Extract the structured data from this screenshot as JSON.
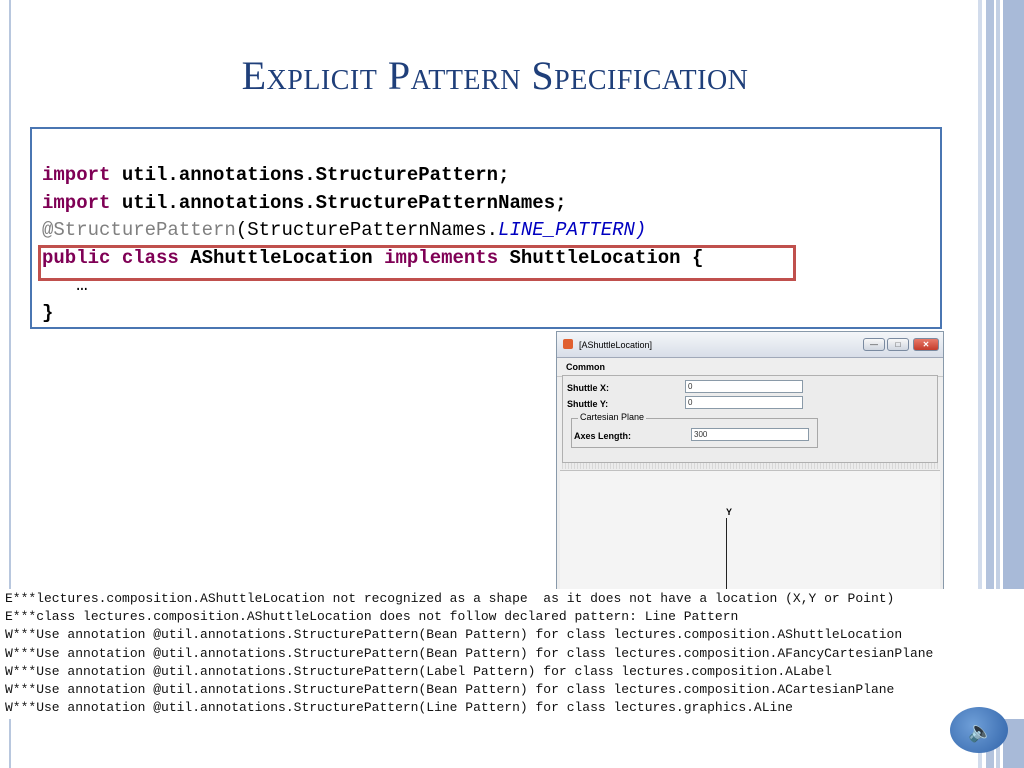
{
  "slide": {
    "title": "Explicit Pattern Specification",
    "code": {
      "line1": {
        "kw": "import",
        "rest": " util.annotations.StructurePattern;"
      },
      "line2": {
        "kw": "import",
        "rest": " util.annotations.StructurePatternNames;"
      },
      "line3": {
        "ann": "@StructurePattern",
        "mid": "(StructurePatternNames.",
        "const": "LINE_PATTERN",
        "end": ")"
      },
      "line4": {
        "kw1": "public",
        "kw2": "class",
        "name": "AShuttleLocation",
        "kw3": "implements",
        "iface": "ShuttleLocation",
        "brace": "{"
      },
      "line5": "…",
      "line6": "}"
    }
  },
  "window": {
    "title": "[AShuttleLocation]",
    "buttons": {
      "minimize": "—",
      "maximize": "□",
      "close": "✕"
    },
    "menu": "Common",
    "fields": [
      {
        "label": "Shuttle X:",
        "value": "0"
      },
      {
        "label": "Shuttle Y:",
        "value": "0"
      }
    ],
    "group": {
      "title": "Cartesian Plane",
      "field_label": "Axes Length:",
      "field_value": "300"
    },
    "canvas_axis_label": "Y"
  },
  "console": [
    "E***lectures.composition.AShuttleLocation not recognized as a shape  as it does not have a location (X,Y or Point)",
    "E***class lectures.composition.AShuttleLocation does not follow declared pattern: Line Pattern",
    "W***Use annotation @util.annotations.StructurePattern(Bean Pattern) for class lectures.composition.AShuttleLocation",
    "W***Use annotation @util.annotations.StructurePattern(Bean Pattern) for class lectures.composition.AFancyCartesianPlane",
    "W***Use annotation @util.annotations.StructurePattern(Label Pattern) for class lectures.composition.ALabel",
    "W***Use annotation @util.annotations.StructurePattern(Bean Pattern) for class lectures.composition.ACartesianPlane",
    "W***Use annotation @util.annotations.StructurePattern(Line Pattern) for class lectures.graphics.ALine"
  ],
  "colors": {
    "title": "#1f3f7a",
    "code_border": "#4a76b2",
    "highlight": "#c0504d",
    "keyword": "#7f0055"
  },
  "icons": {
    "window": "java-cup-icon",
    "speaker": "speaker-icon"
  }
}
